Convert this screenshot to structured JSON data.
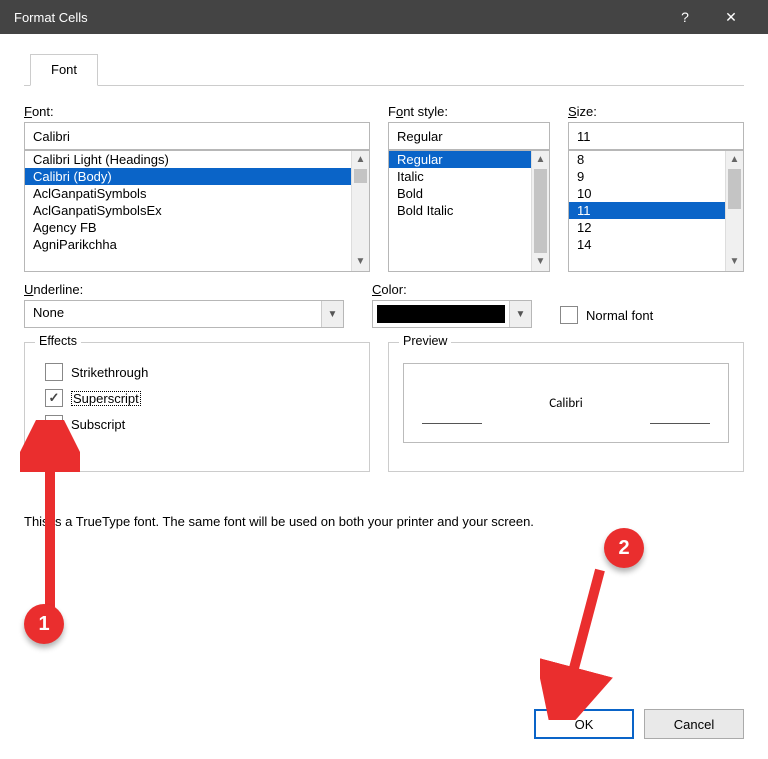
{
  "title": "Format Cells",
  "tab": "Font",
  "labels": {
    "font": "Font:",
    "font_u": "F",
    "fontstyle": "Font style:",
    "fontstyle_u": "o",
    "size": "Size:",
    "size_u": "S",
    "underline": "Underline:",
    "underline_u": "U",
    "color": "Color:",
    "color_u": "C",
    "normalfont": "Normal font",
    "effects": "Effects",
    "strike": "Strikethrough",
    "superscript": "Superscript",
    "subscript": "Subscript",
    "preview": "Preview"
  },
  "font": {
    "value": "Calibri",
    "items": [
      "Calibri Light (Headings)",
      "Calibri (Body)",
      "AclGanpatiSymbols",
      "AclGanpatiSymbolsEx",
      "Agency FB",
      "AgniParikchha"
    ],
    "selected_index": 1
  },
  "fontstyle": {
    "value": "Regular",
    "items": [
      "Regular",
      "Italic",
      "Bold",
      "Bold Italic"
    ],
    "selected_index": 0
  },
  "size": {
    "value": "11",
    "items": [
      "8",
      "9",
      "10",
      "11",
      "12",
      "14"
    ],
    "selected_index": 3
  },
  "underline": {
    "value": "None"
  },
  "effects": {
    "strike": false,
    "superscript": true,
    "subscript": false
  },
  "normalfont": false,
  "preview_text": "Calibri",
  "truetype_note": "This is a TrueType font.  The same font will be used on both your printer and your screen.",
  "buttons": {
    "ok": "OK",
    "cancel": "Cancel"
  },
  "annotations": {
    "a1": "1",
    "a2": "2"
  }
}
